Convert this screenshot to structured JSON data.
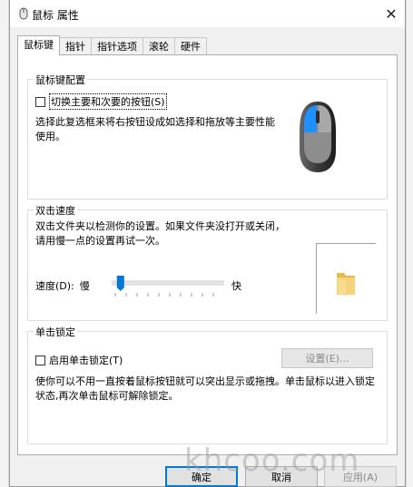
{
  "window": {
    "title": "鼠标 属性",
    "close_glyph": "✕"
  },
  "tabs": [
    {
      "label": "鼠标键"
    },
    {
      "label": "指针"
    },
    {
      "label": "指针选项"
    },
    {
      "label": "滚轮"
    },
    {
      "label": "硬件"
    }
  ],
  "button_config": {
    "legend": "鼠标键配置",
    "swap_label": "切换主要和次要的按钮(S)",
    "description": "选择此复选框来将右按钮设成如选择和拖放等主要性能使用。"
  },
  "double_click": {
    "legend": "双击速度",
    "description": "双击文件夹以检测你的设置。如果文件夹没打开或关闭，请用慢一点的设置再试一次。",
    "speed_label": "速度(D):",
    "slow_label": "慢",
    "fast_label": "快",
    "speed_value": 0.05
  },
  "click_lock": {
    "legend": "单击锁定",
    "enable_label": "启用单击锁定(T)",
    "settings_label": "设置(E)...",
    "description": "使你可以不用一直按着鼠标按钮就可以突出显示或拖拽。单击鼠标以进入锁定状态,再次单击鼠标可解除锁定。"
  },
  "footer": {
    "ok_label": "确定",
    "cancel_label": "取消",
    "apply_label": "应用(A)"
  },
  "watermark": "khcoo.com",
  "colors": {
    "accent": "#0078d7",
    "mouse_button": "#1e90ff"
  }
}
